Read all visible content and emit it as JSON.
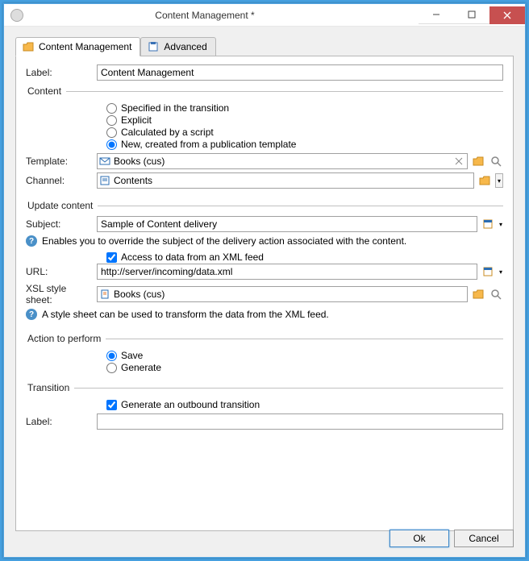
{
  "window": {
    "title": "Content Management *"
  },
  "tabs": {
    "content_management": "Content Management",
    "advanced": "Advanced"
  },
  "labels": {
    "label": "Label:",
    "template": "Template:",
    "channel": "Channel:",
    "subject": "Subject:",
    "url": "URL:",
    "xsl": "XSL style sheet:",
    "transition_label": "Label:"
  },
  "values": {
    "label": "Content Management",
    "template": "Books (cus)",
    "channel": "Contents",
    "subject": "Sample of Content delivery",
    "url": "http://server/incoming/data.xml",
    "xsl": "Books (cus)",
    "transition_label": ""
  },
  "groups": {
    "content": "Content",
    "update_content": "Update content",
    "action": "Action to perform",
    "transition": "Transition"
  },
  "radios": {
    "content": {
      "specified": "Specified in the transition",
      "explicit": "Explicit",
      "calculated": "Calculated by a script",
      "new": "New, created from a publication template"
    },
    "action": {
      "save": "Save",
      "generate": "Generate"
    }
  },
  "checks": {
    "xml_feed": "Access to data from an XML feed",
    "outbound": "Generate an outbound transition"
  },
  "hints": {
    "subject": "Enables you to override the subject of the delivery action associated with the content.",
    "xsl": "A style sheet can be used to transform the data from the XML feed."
  },
  "buttons": {
    "ok": "Ok",
    "cancel": "Cancel"
  }
}
